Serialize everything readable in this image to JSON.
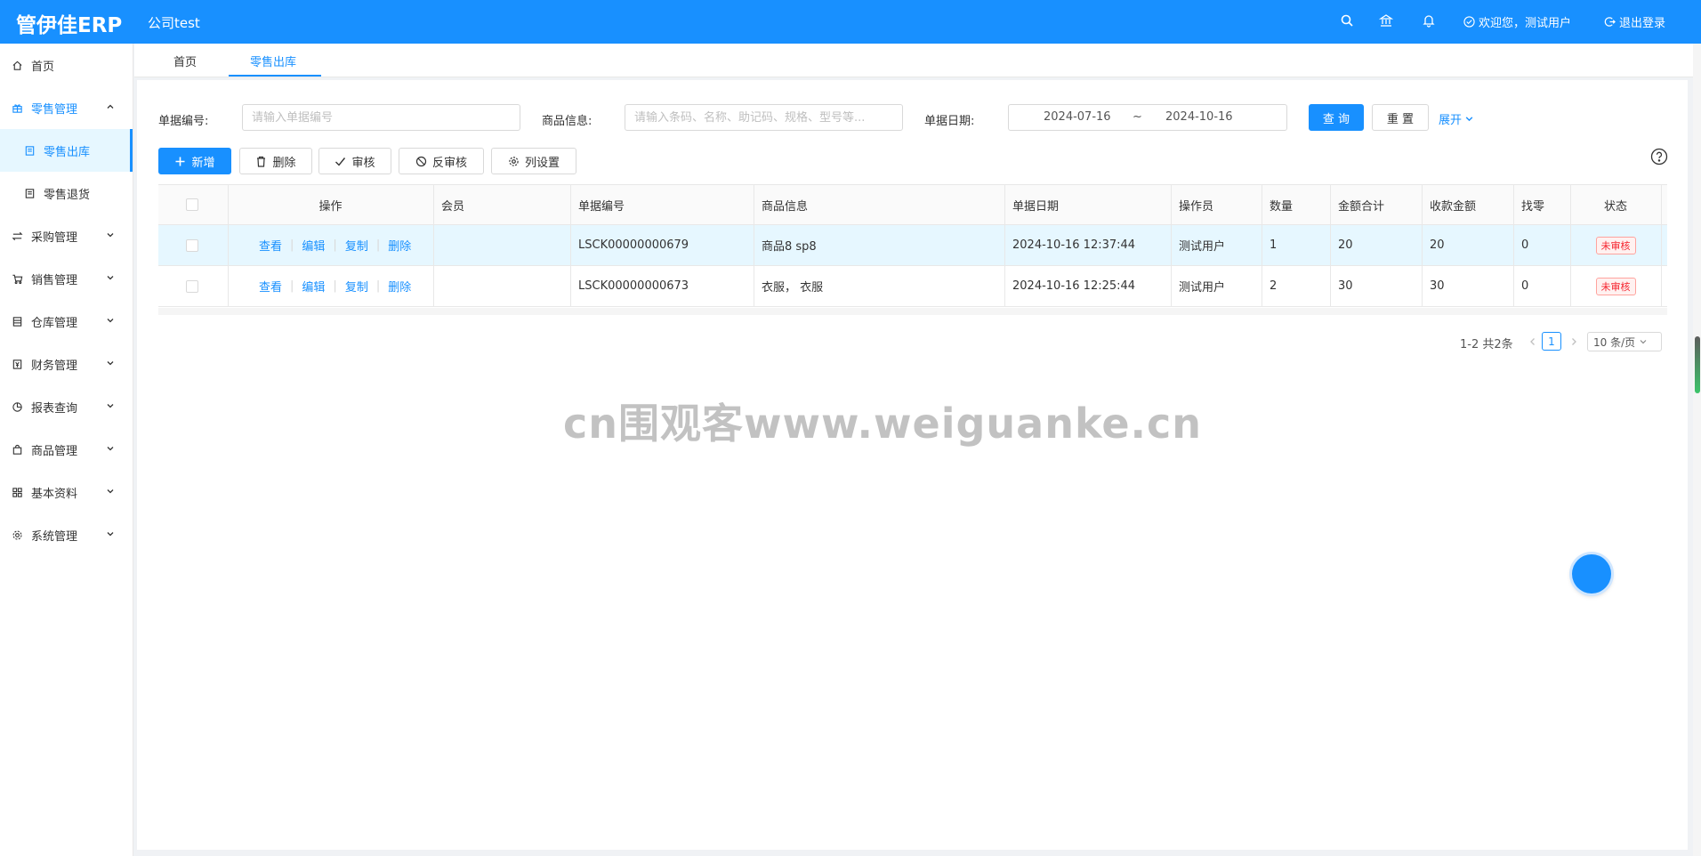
{
  "header": {
    "logo": "管伊佳ERP",
    "company": "公司test",
    "welcome": "欢迎您，测试用户",
    "logout": "退出登录",
    "icons": [
      "search-icon",
      "bank-icon",
      "bell-icon"
    ]
  },
  "sidebar": {
    "items": [
      {
        "label": "首页",
        "icon": "home-icon"
      },
      {
        "label": "零售管理",
        "icon": "gift-icon",
        "open": true
      },
      {
        "label": "零售出库",
        "icon": "doc-icon",
        "active": true
      },
      {
        "label": "零售退货",
        "icon": "doc-icon"
      },
      {
        "label": "采购管理",
        "icon": "swap-icon"
      },
      {
        "label": "销售管理",
        "icon": "cart-icon"
      },
      {
        "label": "仓库管理",
        "icon": "warehouse-icon"
      },
      {
        "label": "财务管理",
        "icon": "money-icon"
      },
      {
        "label": "报表查询",
        "icon": "pie-icon"
      },
      {
        "label": "商品管理",
        "icon": "bag-icon"
      },
      {
        "label": "基本资料",
        "icon": "grid-icon"
      },
      {
        "label": "系统管理",
        "icon": "gear-icon"
      }
    ]
  },
  "tabs": [
    {
      "label": "首页"
    },
    {
      "label": "零售出库",
      "active": true
    }
  ],
  "filters": {
    "bill_no_label": "单据编号:",
    "bill_no_placeholder": "请输入单据编号",
    "goods_label": "商品信息:",
    "goods_placeholder": "请输入条码、名称、助记码、规格、型号等...",
    "date_label": "单据日期:",
    "date_start": "2024-07-16",
    "date_sep": "~",
    "date_end": "2024-10-16",
    "query": "查 询",
    "reset": "重 置",
    "expand": "展开"
  },
  "toolbar": {
    "add": "新增",
    "delete": "删除",
    "audit": "审核",
    "unaudit": "反审核",
    "columns": "列设置"
  },
  "table": {
    "headers": [
      "操作",
      "会员",
      "单据编号",
      "商品信息",
      "单据日期",
      "操作员",
      "数量",
      "金额合计",
      "收款金额",
      "找零",
      "状态"
    ],
    "actions": [
      "查看",
      "编辑",
      "复制",
      "删除"
    ],
    "rows": [
      {
        "member": "",
        "bill_no": "LSCK00000000679",
        "goods": "商品8 sp8",
        "date": "2024-10-16 12:37:44",
        "operator": "测试用户",
        "qty": "1",
        "total": "20",
        "received": "20",
        "change": "0",
        "status": "未审核"
      },
      {
        "member": "",
        "bill_no": "LSCK00000000673",
        "goods": "衣服， 衣服",
        "date": "2024-10-16 12:25:44",
        "operator": "测试用户",
        "qty": "2",
        "total": "30",
        "received": "30",
        "change": "0",
        "status": "未审核"
      }
    ]
  },
  "pagination": {
    "total_text": "1-2 共2条",
    "current": "1",
    "page_size": "10 条/页"
  },
  "watermark": "cn围观客www.weiguanke.cn",
  "colors": {
    "primary": "#1890ff",
    "status_red": "#f5222d"
  }
}
